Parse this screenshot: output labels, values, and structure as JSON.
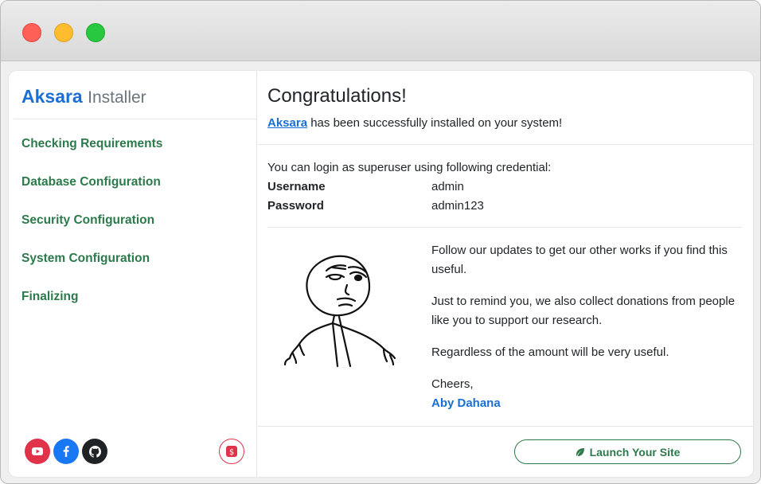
{
  "brand": {
    "name": "Aksara",
    "suffix": "Installer"
  },
  "steps": [
    {
      "label": "Checking Requirements"
    },
    {
      "label": "Database Configuration"
    },
    {
      "label": "Security Configuration"
    },
    {
      "label": "System Configuration"
    },
    {
      "label": "Finalizing"
    }
  ],
  "social": {
    "icons": [
      "youtube-icon",
      "facebook-icon",
      "github-icon"
    ],
    "donate_icon": "dollar-icon"
  },
  "main": {
    "title": "Congratulations!",
    "subtitle_link": "Aksara",
    "subtitle_rest": "has been successfully installed on your system!",
    "cred_intro": "You can login as superuser using following credential:",
    "credentials": [
      {
        "key": "Username",
        "value": "admin"
      },
      {
        "key": "Password",
        "value": "admin123"
      }
    ],
    "paragraphs": [
      "Follow our updates to get our other works if you find this useful.",
      "Just to remind you, we also collect donations from people like you to support our research.",
      "Regardless of the amount will be very useful.",
      "Cheers,"
    ],
    "signature": "Aby Dahana",
    "launch_label": "Launch Your Site"
  },
  "colors": {
    "brand": "#1a6fd6",
    "steps": "#2c7a4b",
    "youtube": "#e0334a",
    "facebook": "#1877f2",
    "github": "#1f2326"
  }
}
